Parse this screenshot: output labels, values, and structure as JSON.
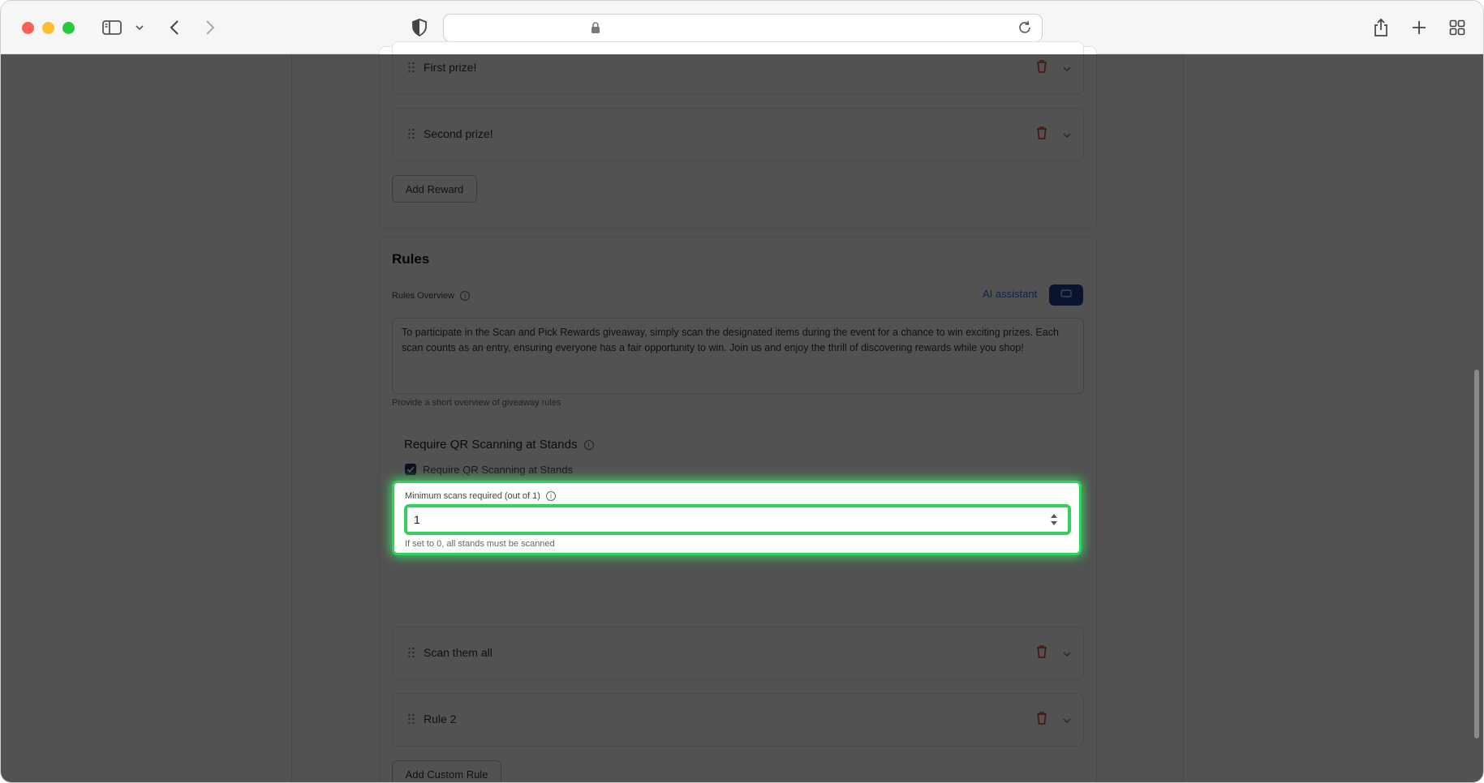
{
  "browser": {
    "url": ""
  },
  "rewards": {
    "items": [
      {
        "label": "First prize!"
      },
      {
        "label": "Second prize!"
      }
    ],
    "add_button": "Add Reward"
  },
  "rules": {
    "title": "Rules",
    "overview_label": "Rules Overview",
    "ai_assistant_label": "AI assistant",
    "overview_text": "To participate in the Scan and Pick Rewards giveaway, simply scan the designated items during the event for a chance to win exciting prizes. Each scan counts as an entry, ensuring everyone has a fair opportunity to win. Join us and enjoy the thrill of discovering rewards while you shop!",
    "overview_hint": "Provide a short overview of giveaway rules",
    "qr_section_title": "Require QR Scanning at Stands",
    "qr_checkbox_label": "Require QR Scanning at Stands",
    "min_scans_label": "Minimum scans required (out of 1)",
    "min_scans_value": "1",
    "min_scans_hint": "If set to 0, all stands must be scanned",
    "custom_rules": [
      {
        "label": "Scan them all"
      },
      {
        "label": "Rule 2"
      }
    ],
    "add_custom_rule_button": "Add Custom Rule"
  },
  "colors": {
    "highlight": "#2fd35c",
    "danger": "#e0403a",
    "primary": "#1f3f8f"
  }
}
